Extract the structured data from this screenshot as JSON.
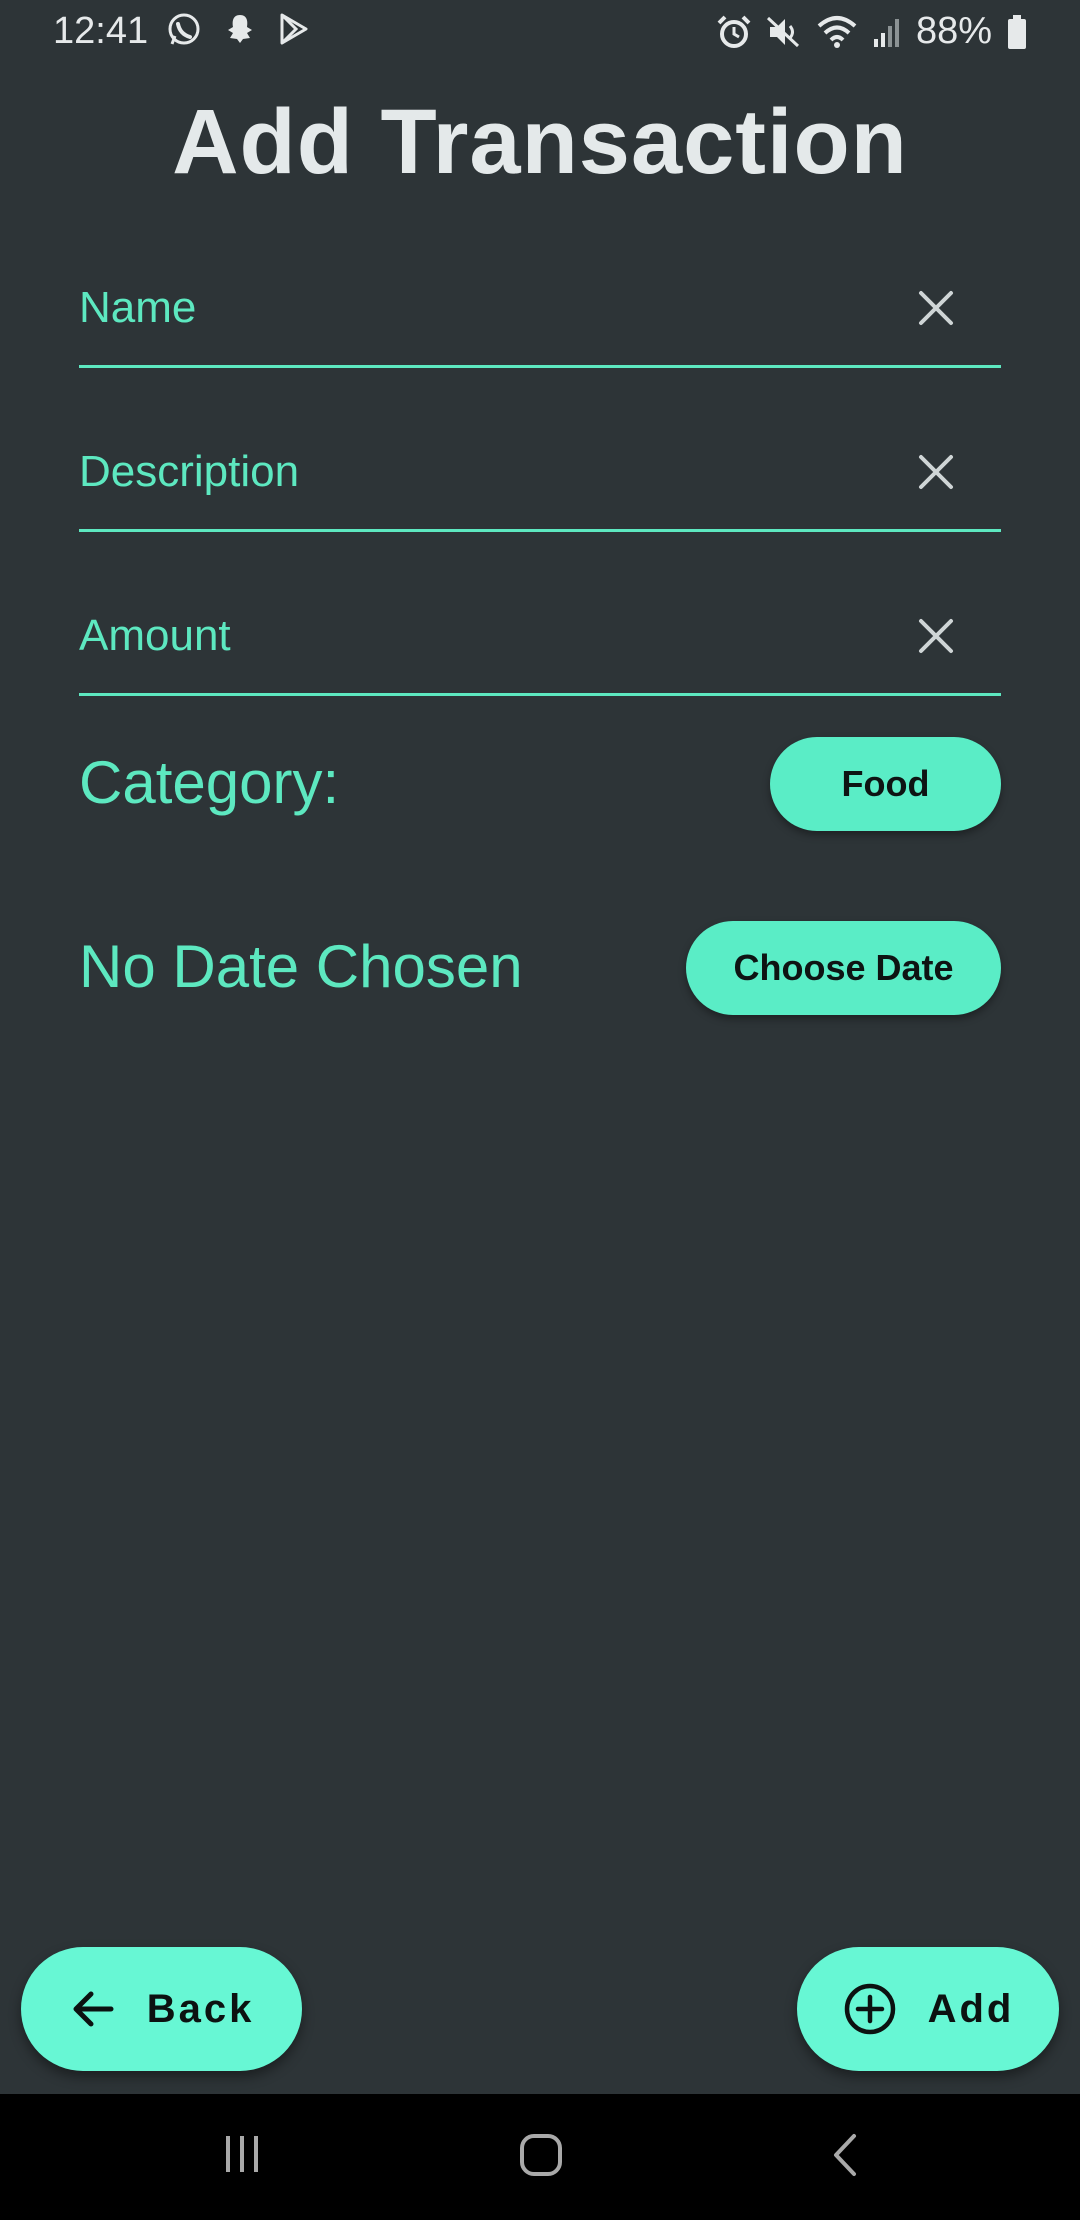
{
  "status_bar": {
    "time": "12:41",
    "battery": "88%",
    "left_icons": [
      "whatsapp-icon",
      "snapchat-icon",
      "play-store-icon"
    ],
    "right_icons": [
      "alarm-icon",
      "mute-icon",
      "wifi-icon",
      "signal-icon",
      "battery-icon"
    ]
  },
  "page": {
    "title": "Add Transaction"
  },
  "form": {
    "name": {
      "placeholder": "Name",
      "value": ""
    },
    "description": {
      "placeholder": "Description",
      "value": ""
    },
    "amount": {
      "placeholder": "Amount",
      "value": ""
    }
  },
  "category": {
    "label": "Category:",
    "selected": "Food"
  },
  "date": {
    "label": "No Date Chosen",
    "button_label": "Choose Date"
  },
  "actions": {
    "back_label": "Back",
    "add_label": "Add"
  },
  "navigation": [
    "recent-apps-icon",
    "home-icon",
    "back-icon"
  ],
  "colors": {
    "background": "#2d3437",
    "accent": "#5de8c0",
    "button": "#67f7d4",
    "title": "#e4e9ea"
  }
}
